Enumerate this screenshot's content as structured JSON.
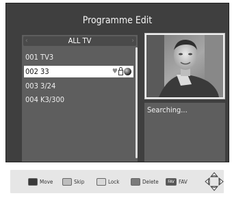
{
  "title": "Programme Edit",
  "channel_group": {
    "label": "ALL TV",
    "left_arrow": "‹",
    "right_arrow": "›"
  },
  "channels": [
    {
      "label": "001 TV3"
    },
    {
      "label": "002 33",
      "selected": true
    },
    {
      "label": "003 3/24"
    },
    {
      "label": "004 K3/300"
    }
  ],
  "preview": {
    "status": "Searching..."
  },
  "legend": {
    "move": "Move",
    "skip": "Skip",
    "lock": "Lock",
    "delete": "Delete",
    "fav": "FAV",
    "fav_key": "FAV"
  },
  "colors": {
    "screen_bg": "#3f3f3f",
    "panel_bg": "#5e5e5e",
    "move_key": "#3a3a3a",
    "skip_key": "#bdbdbd",
    "lock_key": "#d8d8d8",
    "delete_key": "#7a7a7a",
    "fav_key": "#555555"
  },
  "icons": [
    "heart-icon",
    "lock-icon",
    "globe-icon",
    "navigation-pad-icon"
  ]
}
